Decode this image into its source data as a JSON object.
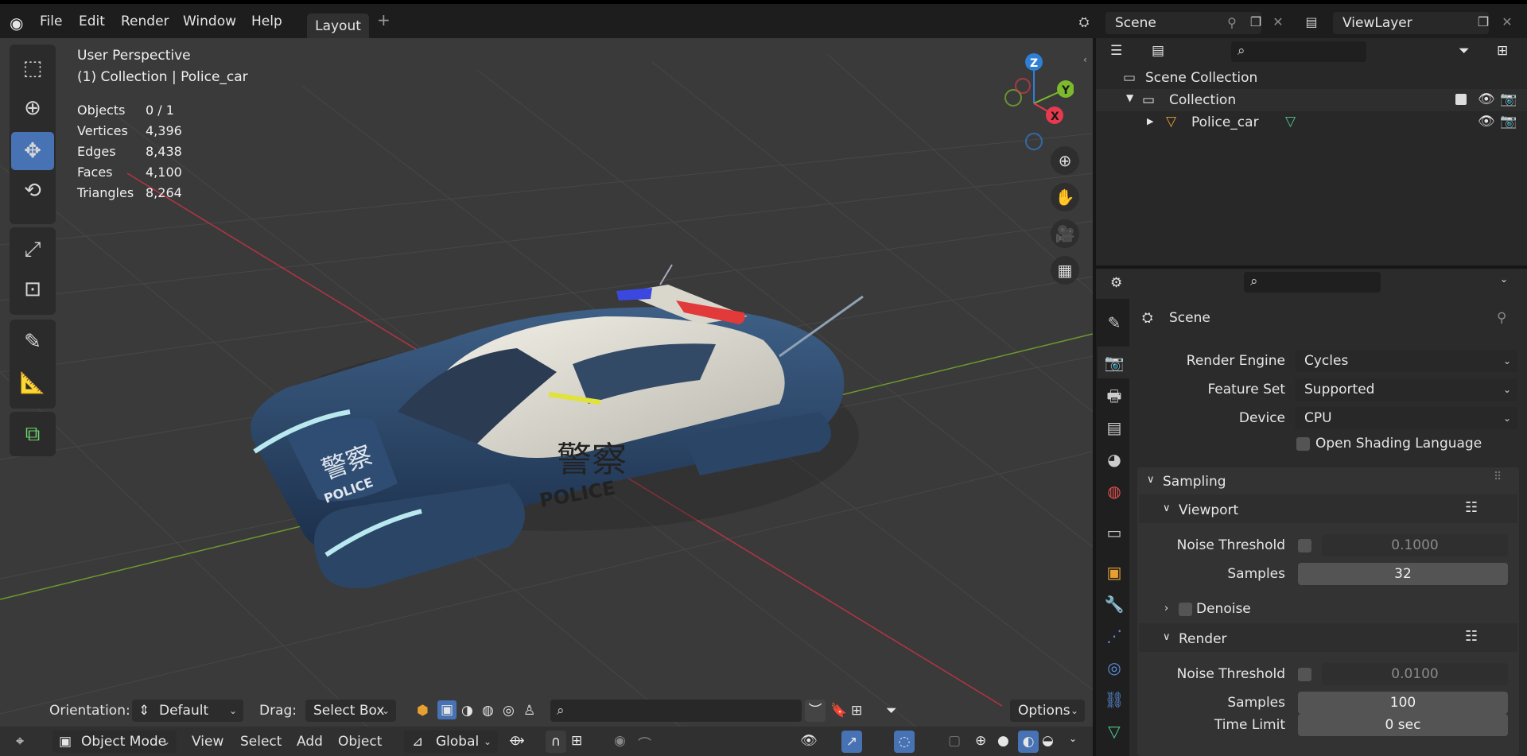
{
  "topbar": {
    "menus": [
      "File",
      "Edit",
      "Render",
      "Window",
      "Help"
    ],
    "workspace_tab": "Layout",
    "add_tab": "+",
    "scene_name": "Scene",
    "viewlayer_name": "ViewLayer"
  },
  "viewport": {
    "view_name": "User Perspective",
    "collection_line": "(1) Collection | Police_car",
    "stats": [
      {
        "label": "Objects",
        "value": "0 / 1"
      },
      {
        "label": "Vertices",
        "value": "4,396"
      },
      {
        "label": "Edges",
        "value": "8,438"
      },
      {
        "label": "Faces",
        "value": "4,100"
      },
      {
        "label": "Triangles",
        "value": "8,264"
      }
    ],
    "gizmo": {
      "z": "Z",
      "y": "Y",
      "x": "X"
    },
    "tool_settings": {
      "orientation_label": "Orientation:",
      "orientation_value": "Default",
      "drag_label": "Drag:",
      "drag_value": "Select Box",
      "options": "Options"
    },
    "header": {
      "mode": "Object Mode",
      "menus": [
        "View",
        "Select",
        "Add",
        "Object"
      ],
      "transform_orientation": "Global"
    },
    "car_text": {
      "chinese": "警察",
      "police": "POLICE"
    }
  },
  "outliner": {
    "scene_collection": "Scene Collection",
    "collection": "Collection",
    "object": "Police_car"
  },
  "properties": {
    "context_title": "Scene",
    "render_engine": {
      "label": "Render Engine",
      "value": "Cycles"
    },
    "feature_set": {
      "label": "Feature Set",
      "value": "Supported"
    },
    "device": {
      "label": "Device",
      "value": "CPU"
    },
    "osl": "Open Shading Language",
    "sampling": "Sampling",
    "viewport_panel": {
      "title": "Viewport",
      "noise_threshold_label": "Noise Threshold",
      "noise_threshold": "0.1000",
      "samples_label": "Samples",
      "samples": "32"
    },
    "denoise": "Denoise",
    "render_panel": {
      "title": "Render",
      "noise_threshold_label": "Noise Threshold",
      "noise_threshold": "0.0100",
      "samples_label": "Samples",
      "samples": "100",
      "time_limit_label": "Time Limit",
      "time_limit": "0 sec"
    }
  },
  "colors": {
    "accent": "#4772b3",
    "axis_x": "#e8394f",
    "axis_y": "#7cb92c",
    "axis_z": "#2f7fd6"
  }
}
